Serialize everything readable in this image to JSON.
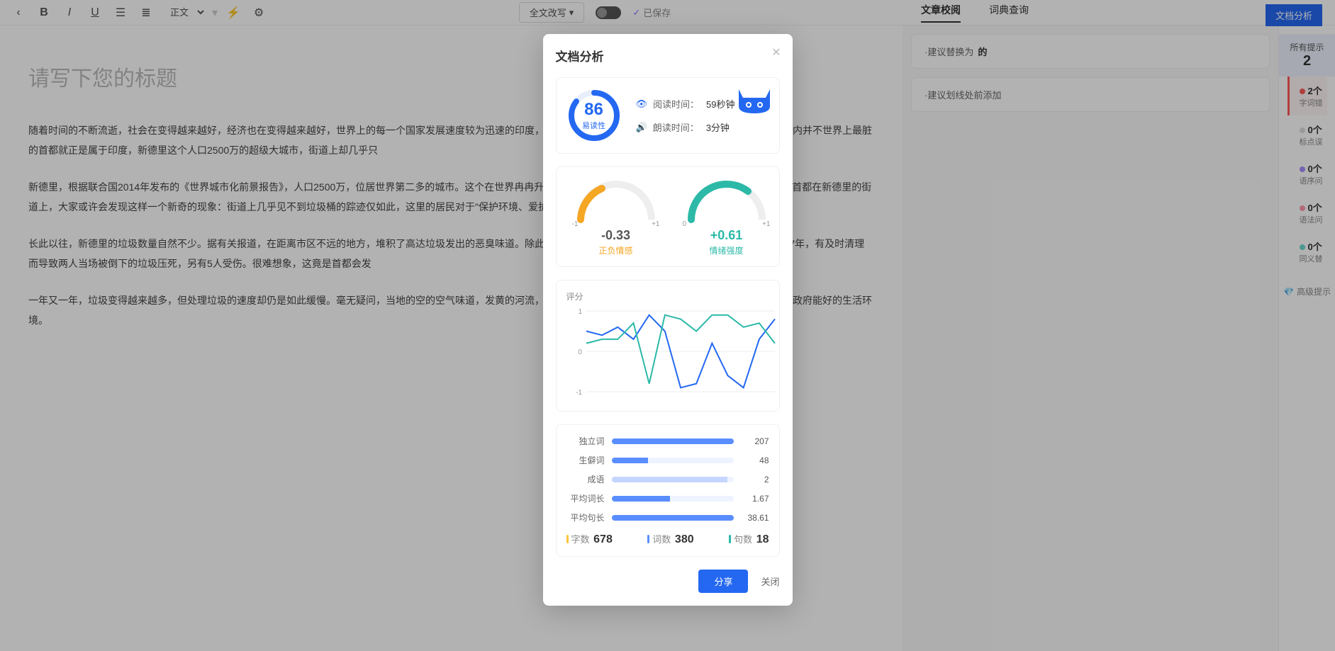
{
  "toolbar": {
    "format_select": "正文",
    "rewrite_btn": "全文改写",
    "saved_label": "已保存",
    "tab_proof": "文章校阅",
    "tab_dict": "词典查询",
    "analyze_btn": "文档分析"
  },
  "editor": {
    "title_placeholder": "请写下您的标题",
    "p1": "随着时间的不断流逝，社会在变得越来越好，经济也在变得越来越好，世界上的每一个国家发展速度较为迅速的印度，自然也不在话下。不过，与其发展速度相对应的，却是国内并不世界上最脏的首都就正是属于印度，新德里这个人口2500万的超级大城市，街道上却几乎只",
    "p2": "新德里，根据联合国2014年发布的《世界城市化前景报告》，人口2500万，位居世界第二多的城市。这个在世界冉冉升起的城市新星，有着数量庞大的人口。不过，即使是身为首都在新德里的街道上，大家或许会发现这样一个新奇的现象：街道上几乎见不到垃圾桶的踪迹仅如此，这里的居民对于\"保护环境、爱护环境\"的意识也是少得可怜，许多新德里的市民都",
    "p3": "长此以往，新德里的垃圾数量自然不少。据有关报道，在距离市区不远的地方，堆积了高达垃圾发出的恶臭味道。除此之外，还有这一件因为垃圾过多而引发的悲剧事件，2017年，有及时清理而导致两人当场被倒下的垃圾压死，另有5人受伤。很难想象，这竟是首都会发",
    "p4": "一年又一年，垃圾变得越来越多，但处理垃圾的速度却仍是如此缓慢。毫无疑问，当地的空的空气味道，发黄的河流，也难怪新德里会被评为是世界上最脏的首都了。希望当地政府能好的生活环境。"
  },
  "suggestions": {
    "s1_pre": "·建议替换为",
    "s1_val": "的",
    "s2": "·建议划线处前添加"
  },
  "rail": {
    "all_label": "所有提示",
    "all_count": "2",
    "items": [
      {
        "count": "2个",
        "label": "字词错",
        "color": "#ff5a5a",
        "active": true
      },
      {
        "count": "0个",
        "label": "标点误",
        "color": "#ddd"
      },
      {
        "count": "0个",
        "label": "语序问",
        "color": "#a890ff"
      },
      {
        "count": "0个",
        "label": "语法问",
        "color": "#ff9aa8"
      },
      {
        "count": "0个",
        "label": "同义替",
        "color": "#6dd9d0"
      }
    ],
    "premium": "高级提示"
  },
  "modal": {
    "title": "文档分析",
    "readability": {
      "score": "86",
      "label": "易读性"
    },
    "read_time_label": "阅读时间：",
    "read_time_val": "59秒钟",
    "speak_time_label": "朗读时间：",
    "speak_time_val": "3分钟",
    "sentiment": {
      "value": "-0.33",
      "label": "正负情感",
      "min": "-1",
      "max": "+1",
      "color": "#f5a623"
    },
    "intensity": {
      "value": "+0.61",
      "label": "情绪强度",
      "min": "0",
      "max": "+1",
      "color": "#2cb9a8"
    },
    "chart_title": "评分",
    "bars": [
      {
        "label": "独立词",
        "value": "207",
        "pct": 100
      },
      {
        "label": "生僻词",
        "value": "48",
        "pct": 30
      },
      {
        "label": "成语",
        "value": "2",
        "pct": 95
      },
      {
        "label": "平均词长",
        "value": "1.67",
        "pct": 48
      },
      {
        "label": "平均句长",
        "value": "38.61",
        "pct": 100
      }
    ],
    "counts": {
      "chars_label": "字数",
      "chars_val": "678",
      "words_label": "词数",
      "words_val": "380",
      "sents_label": "句数",
      "sents_val": "18"
    },
    "share": "分享",
    "close": "关闭"
  },
  "chart_data": {
    "type": "line",
    "title": "评分",
    "ylabel": "",
    "xlabel": "",
    "ylim": [
      -1,
      1
    ],
    "yticks": [
      -1,
      0,
      1
    ],
    "series": [
      {
        "name": "series1",
        "color": "#2468f2",
        "values": [
          0.5,
          0.4,
          0.6,
          0.3,
          0.9,
          0.5,
          -0.9,
          -0.8,
          0.2,
          -0.6,
          -0.9,
          0.3,
          0.8
        ]
      },
      {
        "name": "series2",
        "color": "#2cb9a8",
        "values": [
          0.2,
          0.3,
          0.3,
          0.7,
          -0.8,
          0.9,
          0.8,
          0.5,
          0.9,
          0.9,
          0.6,
          0.7,
          0.2
        ]
      }
    ]
  }
}
